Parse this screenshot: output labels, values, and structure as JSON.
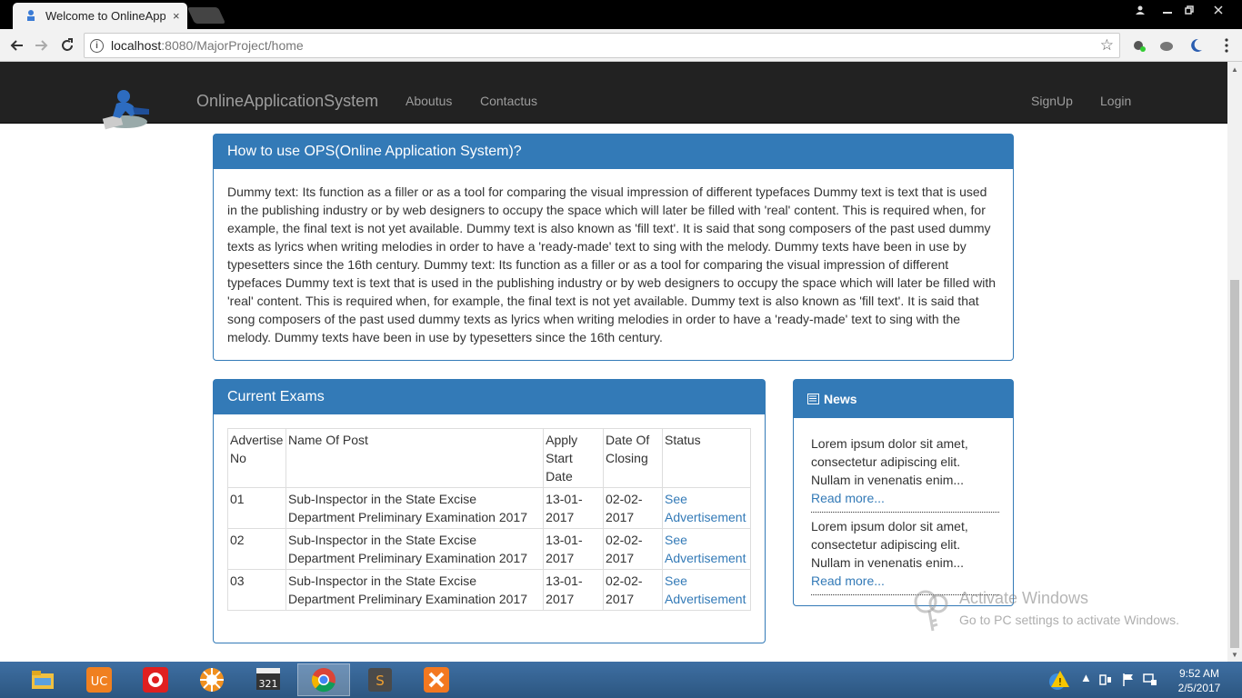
{
  "browser": {
    "tab_title": "Welcome to OnlineApplic",
    "tab_close": "×",
    "url_host": "localhost",
    "url_rest": ":8080/MajorProject/home",
    "icons": [
      "back-arrow-icon",
      "forward-arrow-icon",
      "reload-icon",
      "info-icon",
      "star-icon"
    ]
  },
  "navbar": {
    "brand": "OnlineApplicationSystem",
    "links": [
      "Aboutus",
      "Contactus"
    ],
    "right_links": [
      "SignUp",
      "Login"
    ]
  },
  "howto": {
    "title": "How to use OPS(Online Application System)?",
    "body": "Dummy text: Its function as a filler or as a tool for comparing the visual impression of different typefaces Dummy text is text that is used in the publishing industry or by web designers to occupy the space which will later be filled with 'real' content. This is required when, for example, the final text is not yet available. Dummy text is also known as 'fill text'. It is said that song composers of the past used dummy texts as lyrics when writing melodies in order to have a 'ready-made' text to sing with the melody. Dummy texts have been in use by typesetters since the 16th century. Dummy text: Its function as a filler or as a tool for comparing the visual impression of different typefaces Dummy text is text that is used in the publishing industry or by web designers to occupy the space which will later be filled with 'real' content. This is required when, for example, the final text is not yet available. Dummy text is also known as 'fill text'. It is said that song composers of the past used dummy texts as lyrics when writing melodies in order to have a 'ready-made' text to sing with the melody. Dummy texts have been in use by typesetters since the 16th century."
  },
  "exams": {
    "title": "Current Exams",
    "headers": [
      "Advertise No",
      "Name Of Post",
      "Apply Start Date",
      "Date Of Closing",
      "Status"
    ],
    "rows": [
      {
        "no": "01",
        "post": "Sub-Inspector in the State Excise Department Preliminary Examination 2017",
        "start": "13-01-2017",
        "close": "02-02-2017",
        "status": "See Advertisement"
      },
      {
        "no": "02",
        "post": "Sub-Inspector in the State Excise Department Preliminary Examination 2017",
        "start": "13-01-2017",
        "close": "02-02-2017",
        "status": "See Advertisement"
      },
      {
        "no": "03",
        "post": "Sub-Inspector in the State Excise Department Preliminary Examination 2017",
        "start": "13-01-2017",
        "close": "02-02-2017",
        "status": "See Advertisement"
      }
    ]
  },
  "news": {
    "title": "News",
    "items": [
      {
        "text": "Lorem ipsum dolor sit amet, consectetur adipiscing elit. Nullam in venenatis enim...",
        "link": "Read more..."
      },
      {
        "text": "Lorem ipsum dolor sit amet, consectetur adipiscing elit. Nullam in venenatis enim...",
        "link": "Read more..."
      }
    ]
  },
  "watermark": {
    "line1": "Activate Windows",
    "line2": "Go to PC settings to activate Windows."
  },
  "taskbar": {
    "apps": [
      "file-explorer",
      "uc-browser",
      "recorder",
      "settings-app",
      "media-player-classic",
      "chrome",
      "sublime-text",
      "xampp"
    ],
    "clock_time": "9:52 AM",
    "clock_date": "2/5/2017"
  },
  "colors": {
    "primary": "#337ab7",
    "navbar": "#222222",
    "taskbar": "#3e6fa3"
  }
}
